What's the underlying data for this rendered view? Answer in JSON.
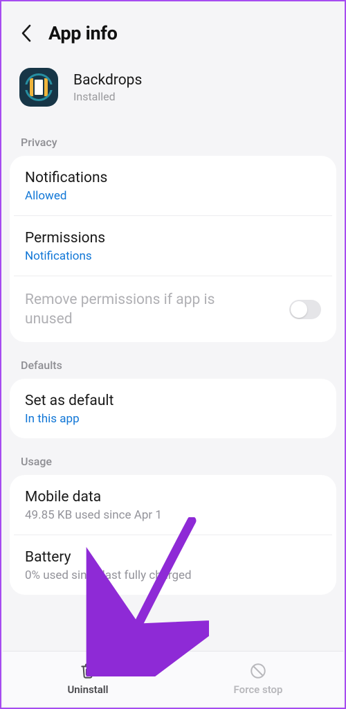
{
  "header": {
    "title": "App info"
  },
  "app": {
    "name": "Backdrops",
    "status": "Installed"
  },
  "sections": {
    "privacy": {
      "label": "Privacy",
      "notifications": {
        "title": "Notifications",
        "sub": "Allowed"
      },
      "permissions": {
        "title": "Permissions",
        "sub": "Notifications"
      },
      "removePerms": {
        "title": "Remove permissions if app is unused"
      }
    },
    "defaults": {
      "label": "Defaults",
      "setDefault": {
        "title": "Set as default",
        "sub": "In this app"
      }
    },
    "usage": {
      "label": "Usage",
      "mobileData": {
        "title": "Mobile data",
        "sub": "49.85 KB used since Apr 1"
      },
      "battery": {
        "title": "Battery",
        "sub": "0% used since last fully charged"
      }
    }
  },
  "bottom": {
    "uninstall": "Uninstall",
    "forceStop": "Force stop"
  }
}
